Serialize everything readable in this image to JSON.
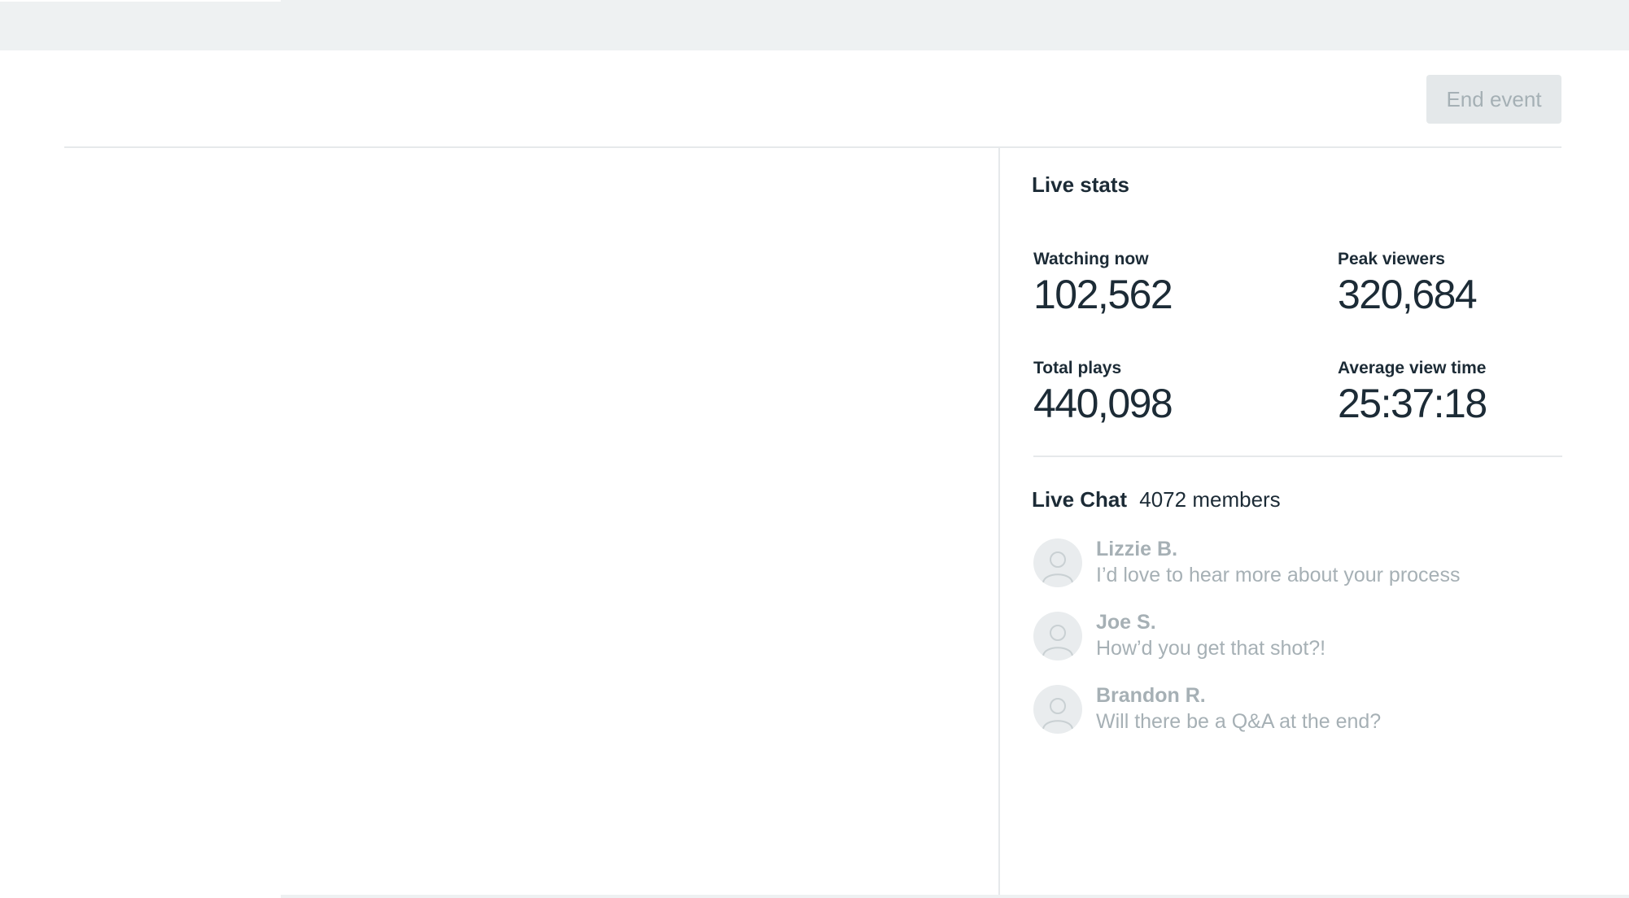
{
  "header": {
    "end_event_label": "End event"
  },
  "live_stats": {
    "title": "Live stats",
    "watching_now": {
      "label": "Watching now",
      "value": "102,562"
    },
    "peak_viewers": {
      "label": "Peak viewers",
      "value": "320,684"
    },
    "total_plays": {
      "label": "Total plays",
      "value": "440,098"
    },
    "average_view_time": {
      "label": "Average view time",
      "value": "25:37:18"
    }
  },
  "live_chat": {
    "title": "Live Chat",
    "members": "4072 members",
    "messages": [
      {
        "author": "Lizzie B.",
        "text": "I’d love to hear more about your process",
        "avatar_icon": "user-icon"
      },
      {
        "author": "Joe S.",
        "text": "How’d you get that shot?!",
        "avatar_icon": "user-icon"
      },
      {
        "author": "Brandon R.",
        "text": "Will there be a Q&A at the end?",
        "avatar_icon": "user-icon"
      }
    ]
  },
  "colors": {
    "topbar": "#eef1f2",
    "primary_text": "#1c2b36",
    "muted_text": "#a6b0b5",
    "button_bg": "#e4e8ea",
    "divider": "#e6e9eb"
  }
}
